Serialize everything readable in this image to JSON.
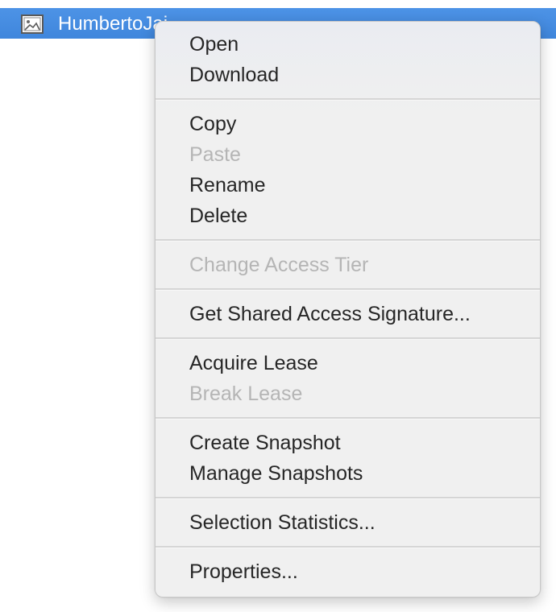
{
  "selected_file": {
    "name": "HumbertoJai",
    "icon": "image-file-icon"
  },
  "menu": {
    "groups": [
      {
        "items": [
          {
            "label": "Open",
            "enabled": true
          },
          {
            "label": "Download",
            "enabled": true
          }
        ]
      },
      {
        "items": [
          {
            "label": "Copy",
            "enabled": true
          },
          {
            "label": "Paste",
            "enabled": false
          },
          {
            "label": "Rename",
            "enabled": true
          },
          {
            "label": "Delete",
            "enabled": true
          }
        ]
      },
      {
        "items": [
          {
            "label": "Change Access Tier",
            "enabled": false
          }
        ]
      },
      {
        "items": [
          {
            "label": "Get Shared Access Signature...",
            "enabled": true
          }
        ]
      },
      {
        "items": [
          {
            "label": "Acquire Lease",
            "enabled": true
          },
          {
            "label": "Break Lease",
            "enabled": false
          }
        ]
      },
      {
        "items": [
          {
            "label": "Create Snapshot",
            "enabled": true
          },
          {
            "label": "Manage Snapshots",
            "enabled": true
          }
        ]
      },
      {
        "items": [
          {
            "label": "Selection Statistics...",
            "enabled": true
          }
        ]
      },
      {
        "items": [
          {
            "label": "Properties...",
            "enabled": true
          }
        ]
      }
    ]
  },
  "colors": {
    "selection": "#4a90e2",
    "menu_background": "#f0f0f0",
    "text": "#262626",
    "disabled_text": "#b5b5b5"
  }
}
